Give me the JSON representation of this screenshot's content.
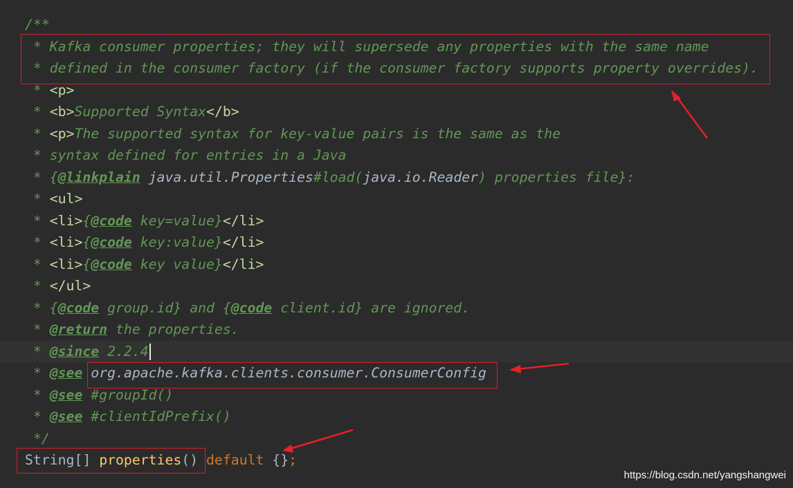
{
  "code": {
    "l1": "/**",
    "l2": " * Kafka consumer properties; they will supersede any properties with the same name",
    "l3": " * defined in the consumer factory (if the consumer factory supports property overrides).",
    "l4_star": " * ",
    "l4_tag": "<p>",
    "l5_star": " * ",
    "l5_tag1": "<b>",
    "l5_text": "Supported Syntax",
    "l5_tag2": "</b>",
    "l6_star": " * ",
    "l6_tag": "<p>",
    "l6_text": "The supported syntax for key-value pairs is the same as the",
    "l7": " * syntax defined for entries in a Java",
    "l8_pre": " * {",
    "l8_ann": "@linkplain",
    "l8_ref": " java.util.Properties",
    "l8_hash": "#load(",
    "l8_ref2": "java.io.Reader",
    "l8_post": ") properties file}:",
    "l9_star": " * ",
    "l9_tag": "<ul>",
    "l10_star": " * ",
    "l10_tag1": "<li>",
    "l10_pre": "{",
    "l10_ann": "@code",
    "l10_text": " key=value}",
    "l10_tag2": "</li>",
    "l11_star": " * ",
    "l11_tag1": "<li>",
    "l11_pre": "{",
    "l11_ann": "@code",
    "l11_text": " key:value}",
    "l11_tag2": "</li>",
    "l12_star": " * ",
    "l12_tag1": "<li>",
    "l12_pre": "{",
    "l12_ann": "@code",
    "l12_text": " key value}",
    "l12_tag2": "</li>",
    "l13_star": " * ",
    "l13_tag": "</ul>",
    "l14_a": " * {",
    "l14_ann1": "@code",
    "l14_b": " group.id} and {",
    "l14_ann2": "@code",
    "l14_c": " client.id} are ignored.",
    "l15_star": " * ",
    "l15_ann": "@return",
    "l15_text": " the properties.",
    "l16_star": " * ",
    "l16_ann": "@since",
    "l16_text": " 2.2.4",
    "l17_star": " * ",
    "l17_ann": "@see",
    "l17_ref": " org.apache.kafka.clients.consumer.ConsumerConfig",
    "l18_star": " * ",
    "l18_ann": "@see",
    "l18_text": " #groupId()",
    "l19_star": " * ",
    "l19_ann": "@see",
    "l19_text": " #clientIdPrefix()",
    "l20": " */",
    "l21_type": "String[] ",
    "l21_method": "properties",
    "l21_parens": "() ",
    "l21_kw": "default",
    "l21_body": " {}",
    "l21_semi": ";"
  },
  "watermark": "https://blog.csdn.net/yangshangwei",
  "colors": {
    "background": "#2b2b2b",
    "comment": "#629755",
    "annotation_box": "#d4202a",
    "arrow": "#e8202a"
  }
}
